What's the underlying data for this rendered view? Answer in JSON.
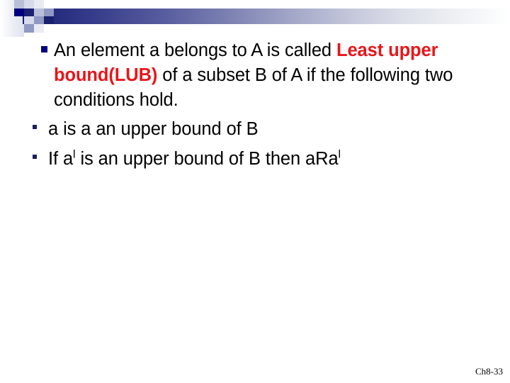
{
  "banner": {
    "gradient_start_color": "#1a1f6e",
    "gradient_end_color": "#ffffff",
    "accent_square_color": "#000080"
  },
  "content": {
    "bullets": [
      {
        "level": 1,
        "marker": "square-bullet",
        "segments": [
          {
            "text": "An element a belongs to A is called ",
            "style": "normal"
          },
          {
            "text": "Least upper bound(LUB)",
            "style": "bold-red"
          },
          {
            "text": " of  a subset B of A if the following two conditions hold.",
            "style": "normal"
          }
        ],
        "plain_text": "An element a belongs to A is called Least upper bound(LUB) of  a subset B of A if the following two conditions hold."
      },
      {
        "level": 2,
        "marker": "square-bullet",
        "segments": [
          {
            "text": "a is a an upper bound of B",
            "style": "normal"
          }
        ],
        "plain_text": "a is a an upper bound of B"
      },
      {
        "level": 2,
        "marker": "square-bullet",
        "segments": [
          {
            "text": "If a",
            "style": "normal"
          },
          {
            "text": "l",
            "style": "superscript"
          },
          {
            "text": " is an upper bound of B then aRa",
            "style": "normal"
          },
          {
            "text": "l",
            "style": "superscript"
          }
        ],
        "plain_text": "If al is an upper bound of B then aRal"
      }
    ]
  },
  "footer": {
    "page_label": "Ch8-33"
  }
}
